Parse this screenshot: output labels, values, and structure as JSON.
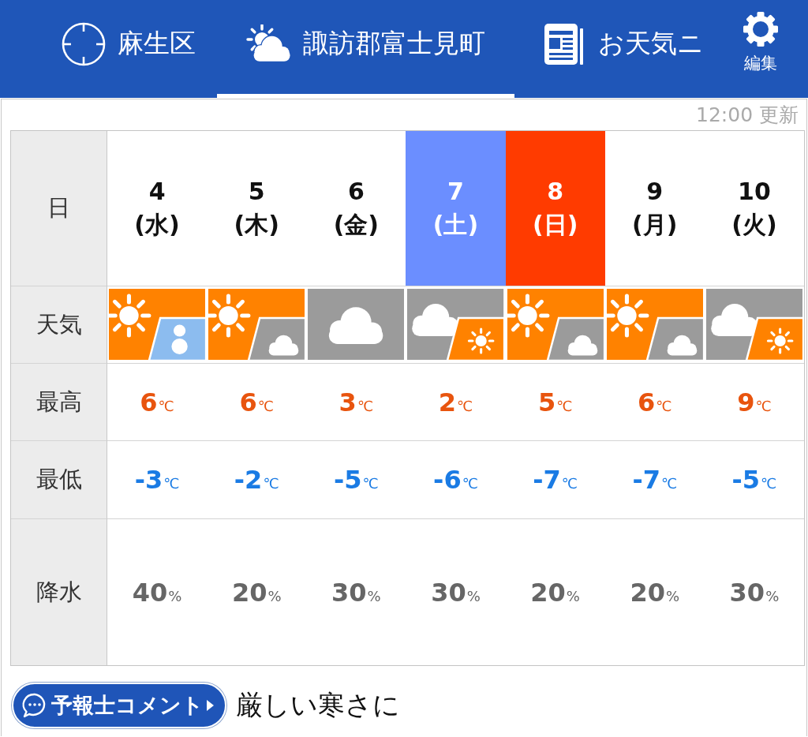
{
  "header": {
    "tabs": [
      {
        "label": "麻生区",
        "kind": "location",
        "selected": false
      },
      {
        "label": "諏訪郡富士見町",
        "kind": "weather",
        "selected": true
      },
      {
        "label": "お天気ニ",
        "kind": "news",
        "selected": false
      }
    ],
    "edit_button": {
      "label": "編集"
    }
  },
  "updated": "12:00 更新",
  "table": {
    "row_labels": [
      "日",
      "天気",
      "最高",
      "最低",
      "降水"
    ],
    "days": [
      {
        "date": "4",
        "weekday": "(水)",
        "weather": {
          "kind": "sun-snow"
        },
        "high": {
          "value": "6",
          "unit": "℃"
        },
        "low": {
          "value": "-3",
          "unit": "℃"
        },
        "precip": {
          "value": "40",
          "unit": "%"
        }
      },
      {
        "date": "5",
        "weekday": "(木)",
        "weather": {
          "kind": "sun-cloud"
        },
        "high": {
          "value": "6",
          "unit": "℃"
        },
        "low": {
          "value": "-2",
          "unit": "℃"
        },
        "precip": {
          "value": "20",
          "unit": "%"
        }
      },
      {
        "date": "6",
        "weekday": "(金)",
        "weather": {
          "kind": "cloud"
        },
        "high": {
          "value": "3",
          "unit": "℃"
        },
        "low": {
          "value": "-5",
          "unit": "℃"
        },
        "precip": {
          "value": "30",
          "unit": "%"
        }
      },
      {
        "date": "7",
        "weekday": "(土)",
        "color": "#6b8eff",
        "weather": {
          "kind": "cloud-sun"
        },
        "high": {
          "value": "2",
          "unit": "℃"
        },
        "low": {
          "value": "-6",
          "unit": "℃"
        },
        "precip": {
          "value": "30",
          "unit": "%"
        }
      },
      {
        "date": "8",
        "weekday": "(日)",
        "color": "#ff3b00",
        "weather": {
          "kind": "sun-cloud"
        },
        "high": {
          "value": "5",
          "unit": "℃"
        },
        "low": {
          "value": "-7",
          "unit": "℃"
        },
        "precip": {
          "value": "20",
          "unit": "%"
        }
      },
      {
        "date": "9",
        "weekday": "(月)",
        "weather": {
          "kind": "sun-cloud"
        },
        "high": {
          "value": "6",
          "unit": "℃"
        },
        "low": {
          "value": "-7",
          "unit": "℃"
        },
        "precip": {
          "value": "20",
          "unit": "%"
        }
      },
      {
        "date": "10",
        "weekday": "(火)",
        "weather": {
          "kind": "cloud-sun"
        },
        "high": {
          "value": "9",
          "unit": "℃"
        },
        "low": {
          "value": "-5",
          "unit": "℃"
        },
        "precip": {
          "value": "30",
          "unit": "%"
        }
      }
    ]
  },
  "comment": {
    "button": "予報士コメント",
    "text": "厳しい寒さに"
  }
}
